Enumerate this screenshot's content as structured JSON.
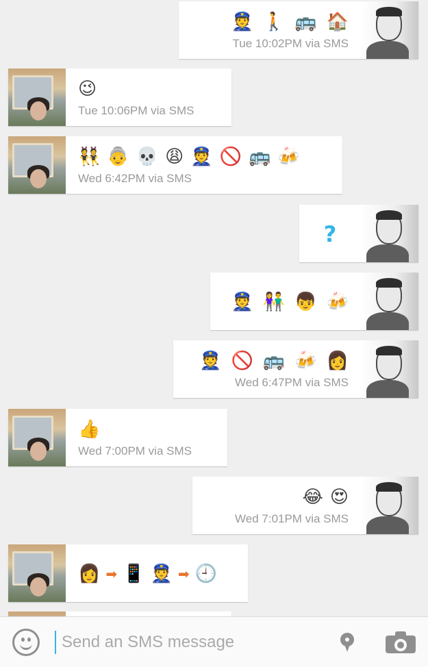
{
  "thread": {
    "messages": [
      {
        "dir": "out",
        "emojis": [
          "👮",
          "🚶",
          "🚌",
          "🏠"
        ],
        "meta": "Tue 10:02PM via SMS"
      },
      {
        "dir": "in",
        "emojis": [
          "😉"
        ],
        "meta": "Tue 10:06PM via SMS"
      },
      {
        "dir": "in",
        "emojis": [
          "👯",
          "👵",
          "💀",
          "😩",
          "👮",
          "🚫",
          "🚌",
          "🍻"
        ],
        "meta": "Wed 6:42PM via SMS"
      },
      {
        "dir": "out",
        "emojis": [
          "?"
        ],
        "meta": ""
      },
      {
        "dir": "out",
        "emojis": [
          "👮",
          "👫",
          "👦",
          "🍻"
        ],
        "meta": ""
      },
      {
        "dir": "out",
        "emojis": [
          "👮",
          "🚫",
          "🚌",
          "🍻",
          "👩"
        ],
        "meta": "Wed 6:47PM via SMS"
      },
      {
        "dir": "in",
        "emojis": [
          "👍"
        ],
        "meta": "Wed 7:00PM via SMS"
      },
      {
        "dir": "out",
        "emojis": [
          "😂",
          "😍"
        ],
        "meta": "Wed 7:01PM via SMS"
      },
      {
        "dir": "in",
        "emojis": [
          "👩",
          "➡",
          "📱",
          "👮",
          "➡",
          "🕘"
        ],
        "meta": ""
      }
    ]
  },
  "composer": {
    "placeholder": "Send an SMS message",
    "emoji_icon": "smiley-icon",
    "location_icon": "location-pin-icon",
    "camera_icon": "camera-icon"
  },
  "colors": {
    "background": "#efefef",
    "accent": "#33b5e5",
    "timestamp": "#9a9a9a"
  }
}
